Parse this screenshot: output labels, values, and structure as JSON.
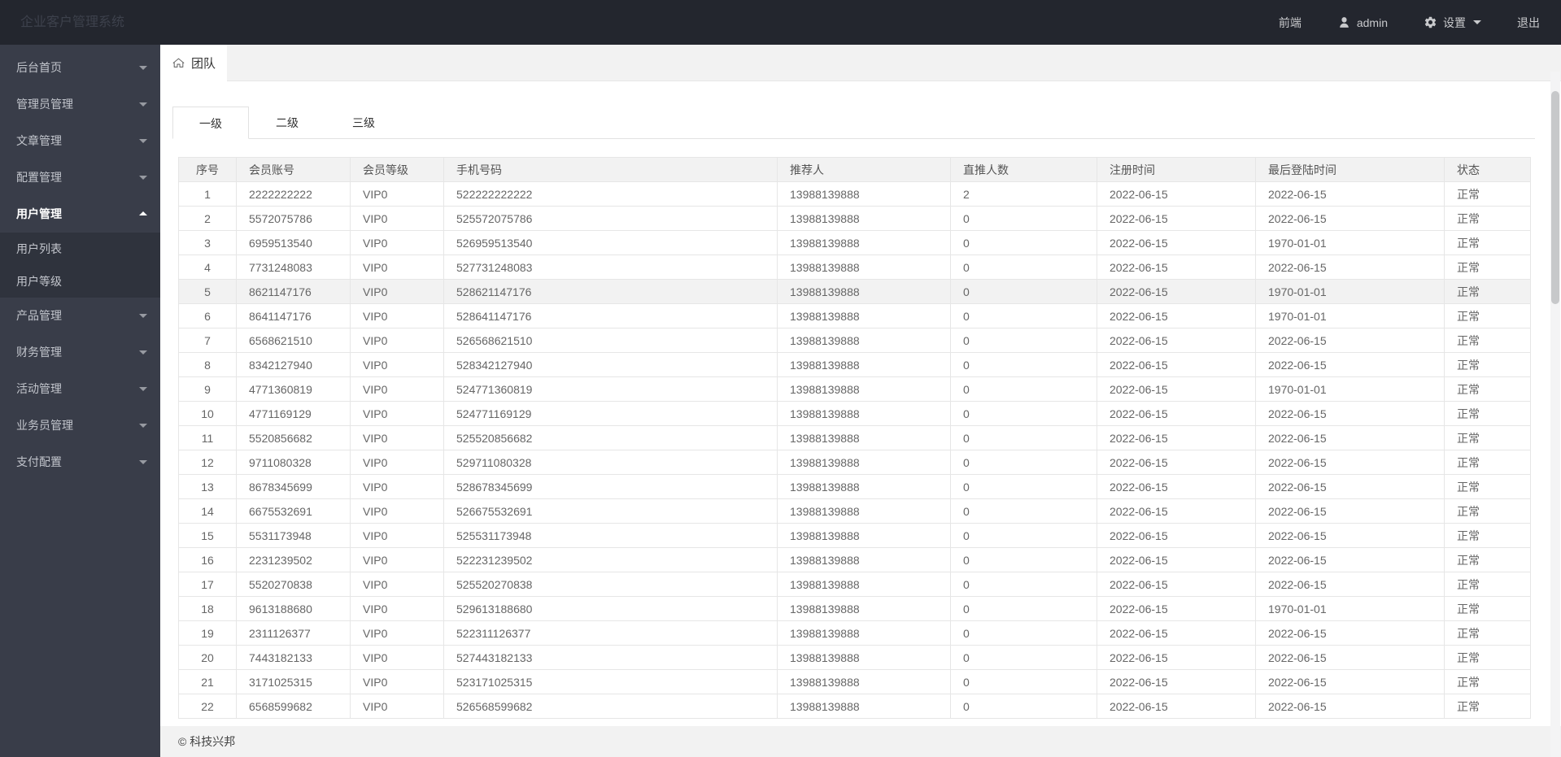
{
  "navbar": {
    "brand": "企业客户管理系统",
    "frontend_label": "前端",
    "username": "admin",
    "settings_label": "设置",
    "logout_label": "退出"
  },
  "sidebar": {
    "items": [
      {
        "label": "后台首页",
        "active": false
      },
      {
        "label": "管理员管理",
        "active": false
      },
      {
        "label": "文章管理",
        "active": false
      },
      {
        "label": "配置管理",
        "active": false
      },
      {
        "label": "用户管理",
        "active": true,
        "children": [
          "用户列表",
          "用户等级"
        ]
      },
      {
        "label": "产品管理",
        "active": false
      },
      {
        "label": "财务管理",
        "active": false
      },
      {
        "label": "活动管理",
        "active": false
      },
      {
        "label": "业务员管理",
        "active": false
      },
      {
        "label": "支付配置",
        "active": false
      }
    ]
  },
  "breadcrumb": {
    "title": "团队"
  },
  "tabs": [
    {
      "label": "一级",
      "active": true
    },
    {
      "label": "二级",
      "active": false
    },
    {
      "label": "三级",
      "active": false
    }
  ],
  "table": {
    "headers": [
      "序号",
      "会员账号",
      "会员等级",
      "手机号码",
      "推荐人",
      "直推人数",
      "注册时间",
      "最后登陆时间",
      "状态"
    ],
    "highlighted_row_number": 5,
    "rows": [
      [
        "1",
        "2222222222",
        "VIP0",
        "522222222222",
        "13988139888",
        "2",
        "2022-06-15",
        "2022-06-15",
        "正常"
      ],
      [
        "2",
        "5572075786",
        "VIP0",
        "525572075786",
        "13988139888",
        "0",
        "2022-06-15",
        "2022-06-15",
        "正常"
      ],
      [
        "3",
        "6959513540",
        "VIP0",
        "526959513540",
        "13988139888",
        "0",
        "2022-06-15",
        "1970-01-01",
        "正常"
      ],
      [
        "4",
        "7731248083",
        "VIP0",
        "527731248083",
        "13988139888",
        "0",
        "2022-06-15",
        "2022-06-15",
        "正常"
      ],
      [
        "5",
        "8621147176",
        "VIP0",
        "528621147176",
        "13988139888",
        "0",
        "2022-06-15",
        "1970-01-01",
        "正常"
      ],
      [
        "6",
        "8641147176",
        "VIP0",
        "528641147176",
        "13988139888",
        "0",
        "2022-06-15",
        "1970-01-01",
        "正常"
      ],
      [
        "7",
        "6568621510",
        "VIP0",
        "526568621510",
        "13988139888",
        "0",
        "2022-06-15",
        "2022-06-15",
        "正常"
      ],
      [
        "8",
        "8342127940",
        "VIP0",
        "528342127940",
        "13988139888",
        "0",
        "2022-06-15",
        "2022-06-15",
        "正常"
      ],
      [
        "9",
        "4771360819",
        "VIP0",
        "524771360819",
        "13988139888",
        "0",
        "2022-06-15",
        "1970-01-01",
        "正常"
      ],
      [
        "10",
        "4771169129",
        "VIP0",
        "524771169129",
        "13988139888",
        "0",
        "2022-06-15",
        "2022-06-15",
        "正常"
      ],
      [
        "11",
        "5520856682",
        "VIP0",
        "525520856682",
        "13988139888",
        "0",
        "2022-06-15",
        "2022-06-15",
        "正常"
      ],
      [
        "12",
        "9711080328",
        "VIP0",
        "529711080328",
        "13988139888",
        "0",
        "2022-06-15",
        "2022-06-15",
        "正常"
      ],
      [
        "13",
        "8678345699",
        "VIP0",
        "528678345699",
        "13988139888",
        "0",
        "2022-06-15",
        "2022-06-15",
        "正常"
      ],
      [
        "14",
        "6675532691",
        "VIP0",
        "526675532691",
        "13988139888",
        "0",
        "2022-06-15",
        "2022-06-15",
        "正常"
      ],
      [
        "15",
        "5531173948",
        "VIP0",
        "525531173948",
        "13988139888",
        "0",
        "2022-06-15",
        "2022-06-15",
        "正常"
      ],
      [
        "16",
        "2231239502",
        "VIP0",
        "522231239502",
        "13988139888",
        "0",
        "2022-06-15",
        "2022-06-15",
        "正常"
      ],
      [
        "17",
        "5520270838",
        "VIP0",
        "525520270838",
        "13988139888",
        "0",
        "2022-06-15",
        "2022-06-15",
        "正常"
      ],
      [
        "18",
        "9613188680",
        "VIP0",
        "529613188680",
        "13988139888",
        "0",
        "2022-06-15",
        "1970-01-01",
        "正常"
      ],
      [
        "19",
        "2311126377",
        "VIP0",
        "522311126377",
        "13988139888",
        "0",
        "2022-06-15",
        "2022-06-15",
        "正常"
      ],
      [
        "20",
        "7443182133",
        "VIP0",
        "527443182133",
        "13988139888",
        "0",
        "2022-06-15",
        "2022-06-15",
        "正常"
      ],
      [
        "21",
        "3171025315",
        "VIP0",
        "523171025315",
        "13988139888",
        "0",
        "2022-06-15",
        "2022-06-15",
        "正常"
      ],
      [
        "22",
        "6568599682",
        "VIP0",
        "526568599682",
        "13988139888",
        "0",
        "2022-06-15",
        "2022-06-15",
        "正常"
      ]
    ]
  },
  "footer": {
    "copyright": "© 科技兴邦"
  },
  "colors": {
    "navbar_bg": "#23262e",
    "sidebar_bg": "#393d49",
    "submenu_bg": "#2f333d",
    "header_row_bg": "#f2f2f2",
    "border": "#e6e6e6"
  }
}
